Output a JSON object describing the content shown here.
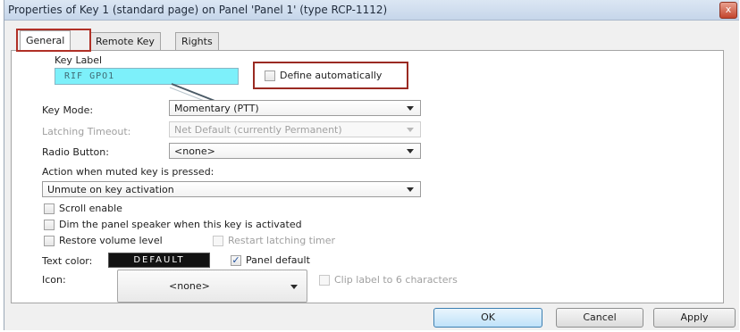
{
  "window": {
    "title": "Properties of Key 1 (standard page) on Panel 'Panel 1' (type RCP-1112)",
    "close_glyph": "x"
  },
  "tabs": [
    {
      "label": "General",
      "active": true
    },
    {
      "label": "Remote Key",
      "active": false
    },
    {
      "label": "Rights",
      "active": false
    }
  ],
  "general": {
    "key_label_caption": "Key Label",
    "key_label_value": "RIF GPO1",
    "define_automatically": {
      "label": "Define automatically",
      "checked": false
    },
    "key_mode": {
      "label": "Key Mode:",
      "value": "Momentary (PTT)"
    },
    "latching_timeout": {
      "label": "Latching Timeout:",
      "value": "Net Default (currently Permanent)",
      "enabled": false
    },
    "radio_button": {
      "label": "Radio Button:",
      "value": "<none>"
    },
    "action_muted": {
      "label": "Action when muted key is pressed:",
      "value": "Unmute on key activation"
    },
    "scroll_enable": {
      "label": "Scroll enable",
      "checked": false
    },
    "dim_speaker": {
      "label": "Dim the panel speaker when this key is activated",
      "checked": false
    },
    "restore_volume": {
      "label": "Restore volume level",
      "checked": false
    },
    "restart_latching": {
      "label": "Restart latching timer",
      "checked": false,
      "enabled": false
    },
    "text_color": {
      "label": "Text color:",
      "button": "DEFAULT",
      "button_bg": "#121212"
    },
    "panel_default": {
      "label": "Panel default",
      "checked": true,
      "glyph": "✓"
    },
    "icon": {
      "label": "Icon:",
      "value": "<none>"
    },
    "clip_label": {
      "label": "Clip label to 6 characters",
      "checked": false,
      "enabled": false
    }
  },
  "buttons": {
    "ok": "OK",
    "cancel": "Cancel",
    "apply": "Apply"
  },
  "colors": {
    "key_label_bg": "#7df0fa",
    "highlight_border": "#b03026",
    "ok_border": "#3c7fb1"
  }
}
